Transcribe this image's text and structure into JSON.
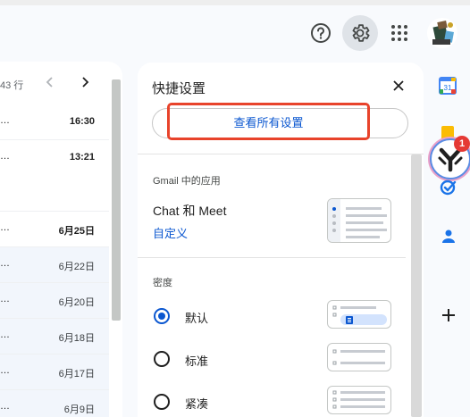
{
  "header": {
    "help_icon": "help-circle-icon",
    "settings_icon": "gear-icon",
    "apps_icon": "apps-grid-icon",
    "avatar_icon": "account-avatar-icon"
  },
  "mail_list": {
    "count_text": "43 行",
    "prev_icon": "chevron-left-icon",
    "next_icon": "chevron-right-icon",
    "rows": [
      {
        "dots": "…",
        "date": "16:30",
        "bold": true
      },
      {
        "dots": "…",
        "date": "13:21",
        "bold": true
      },
      {
        "dots": "…",
        "date": "6月25日",
        "bold": true
      },
      {
        "dots": "…",
        "date": "6月22日",
        "bold": false
      },
      {
        "dots": "…",
        "date": "6月20日",
        "bold": false
      },
      {
        "dots": "…",
        "date": "6月18日",
        "bold": false
      },
      {
        "dots": "…",
        "date": "6月17日",
        "bold": false
      },
      {
        "dots": "…",
        "date": "6月9日",
        "bold": false
      }
    ]
  },
  "quick_settings": {
    "title": "快捷设置",
    "close_icon": "close-icon",
    "view_all_label": "查看所有设置",
    "apps_section": {
      "label": "Gmail 中的应用",
      "app_name": "Chat 和 Meet",
      "customize_label": "自定义"
    },
    "density_section": {
      "label": "密度",
      "options": [
        {
          "label": "默认",
          "selected": true
        },
        {
          "label": "标准",
          "selected": false
        },
        {
          "label": "紧凑",
          "selected": false
        }
      ]
    }
  },
  "side_panel": {
    "calendar_icon": "calendar-icon",
    "calendar_number": "31",
    "keep_icon": "keep-icon",
    "notification_count": "1",
    "tasks_icon": "tasks-icon",
    "contacts_icon": "contacts-icon",
    "add_icon": "add-icon"
  },
  "colors": {
    "accent": "#0b57d0",
    "highlight_border": "#e8432b",
    "badge": "#e53935"
  }
}
